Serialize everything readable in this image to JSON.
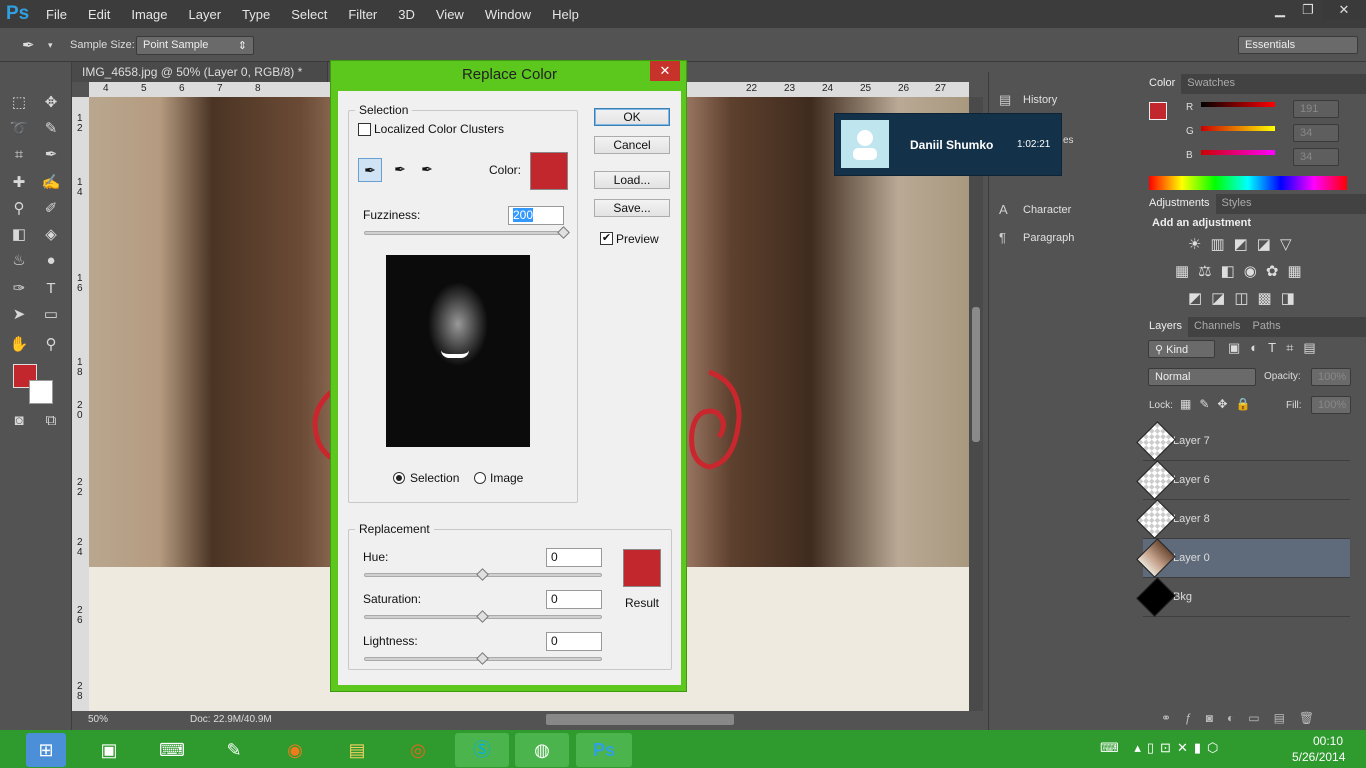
{
  "app": {
    "logo": "Ps",
    "menu": [
      "File",
      "Edit",
      "Image",
      "Layer",
      "Type",
      "Select",
      "Filter",
      "3D",
      "View",
      "Window",
      "Help"
    ]
  },
  "options_bar": {
    "sample_size_label": "Sample Size:",
    "sample_size_value": "Point Sample",
    "workspace": "Essentials"
  },
  "document": {
    "tab_title": "IMG_4658.jpg @ 50% (Layer 0, RGB/8) *",
    "zoom": "50%",
    "doc_size": "Doc: 22.9M/40.9M",
    "h_ruler_ticks": [
      "4",
      "5",
      "6",
      "7",
      "8",
      "22",
      "23",
      "24",
      "25",
      "26",
      "27"
    ],
    "v_ruler_ticks": [
      "1",
      "2",
      "1",
      "4",
      "1",
      "6",
      "1",
      "8",
      "2",
      "0",
      "2",
      "2",
      "2",
      "4",
      "2",
      "6",
      "2",
      "8"
    ]
  },
  "right_dock_collapsed": {
    "items": [
      "History",
      "Character",
      "Paragraph"
    ]
  },
  "color_panel": {
    "tabs": [
      "Color",
      "Swatches"
    ],
    "r_label": "R",
    "g_label": "G",
    "b_label": "B",
    "r_value": "191",
    "g_value": "34",
    "b_value": "34",
    "fg_color": "#c1272d"
  },
  "adjustments_panel": {
    "tabs": [
      "Adjustments",
      "Styles"
    ],
    "heading": "Add an adjustment"
  },
  "layers_panel": {
    "tabs": [
      "Layers",
      "Channels",
      "Paths"
    ],
    "kind_label": "Kind",
    "blend_mode": "Normal",
    "opacity_label": "Opacity:",
    "opacity_value": "100%",
    "lock_label": "Lock:",
    "fill_label": "Fill:",
    "fill_value": "100%",
    "layers": [
      {
        "name": "Layer 7"
      },
      {
        "name": "Layer 6"
      },
      {
        "name": "Layer 8"
      },
      {
        "name": "Layer 0"
      },
      {
        "name": "Bkg"
      }
    ]
  },
  "dialog": {
    "title": "Replace Color",
    "selection_legend": "Selection",
    "localized_label": "Localized Color Clusters",
    "color_label": "Color:",
    "fuzziness_label": "Fuzziness:",
    "fuzziness_value": "200",
    "radio_selection": "Selection",
    "radio_image": "Image",
    "ok": "OK",
    "cancel": "Cancel",
    "load": "Load...",
    "save": "Save...",
    "preview_label": "Preview",
    "replacement_legend": "Replacement",
    "hue_label": "Hue:",
    "hue_value": "0",
    "saturation_label": "Saturation:",
    "saturation_value": "0",
    "lightness_label": "Lightness:",
    "lightness_value": "0",
    "result_label": "Result",
    "selection_color": "#c1272d",
    "result_color": "#c1272d",
    "close_symbol": "✕"
  },
  "notification": {
    "name": "Daniil Shumko",
    "time": "1:02:21",
    "partial_text": "es"
  },
  "taskbar": {
    "time": "00:10",
    "date": "5/26/2014"
  }
}
